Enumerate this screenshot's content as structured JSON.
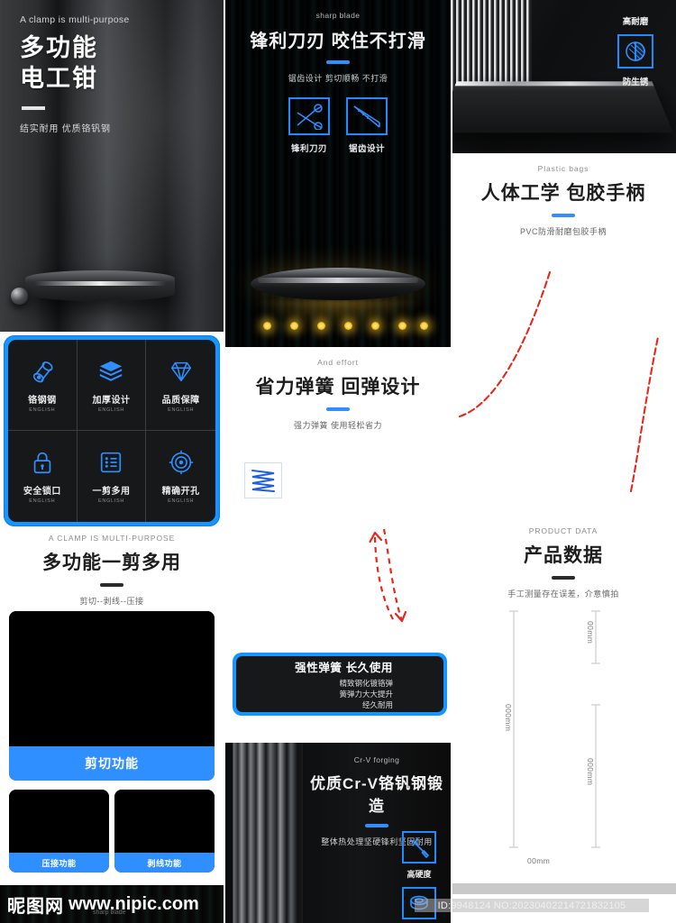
{
  "hero": {
    "eyebrow": "A clamp is multi-purpose",
    "title_line1": "多功能",
    "title_line2": "电工钳",
    "tagline": "结实耐用 优质铬钒钢"
  },
  "feature_grid": {
    "items": [
      {
        "label": "铬钢钢",
        "english": "ENGLISH",
        "icon": "steel-bar-icon"
      },
      {
        "label": "加厚设计",
        "english": "ENGLISH",
        "icon": "layers-icon"
      },
      {
        "label": "品质保障",
        "english": "ENGLISH",
        "icon": "diamond-icon"
      },
      {
        "label": "安全锁口",
        "english": "ENGLISH",
        "icon": "lock-icon"
      },
      {
        "label": "一剪多用",
        "english": "ENGLISH",
        "icon": "list-icon"
      },
      {
        "label": "精确开孔",
        "english": "ENGLISH",
        "icon": "target-icon"
      }
    ]
  },
  "multipurpose": {
    "eyebrow": "A CLAMP IS MULTI-PURPOSE",
    "title": "多功能一剪多用",
    "subtitle": "剪切--剥线--压接"
  },
  "function_cards": {
    "main": {
      "caption": "剪切功能"
    },
    "left": {
      "caption": "压接功能"
    },
    "right": {
      "caption": "剥线功能"
    }
  },
  "footer_watermark": {
    "brand": "昵图网",
    "url": "www.nipic.com",
    "small": "sharp blade"
  },
  "blade": {
    "eyebrow": "sharp blade",
    "title": "锋利刀刃 咬住不打滑",
    "subtitle": "锯齿设计 剪切顺畅 不打滑",
    "icons": [
      {
        "label": "锋利刀刃",
        "icon": "scissors-icon"
      },
      {
        "label": "锯齿设计",
        "icon": "serrated-blade-icon"
      }
    ]
  },
  "spring": {
    "eyebrow": "And effort",
    "title": "省力弹簧 回弹设计",
    "subtitle": "强力弹簧 使用轻松省力",
    "icon": "spring-coil-icon"
  },
  "spring_box": {
    "title": "强性弹簧 长久使用",
    "line1": "精致钢化镀铬弹",
    "line2": "簧弹力大大提升",
    "line3": "经久耐用"
  },
  "crv": {
    "eyebrow": "Cr-V forging",
    "title": "优质Cr-V铬钒钢锻造",
    "subtitle": "整体热处理坚硬锋利坚固耐用",
    "icons": [
      {
        "label": "高硬度",
        "icon": "hammer-icon"
      },
      {
        "label": "",
        "icon": "ring-icon"
      }
    ]
  },
  "rust": {
    "top_label": "高耐磨",
    "bottom_label": "防生锈",
    "icon": "polish-contrast-icon"
  },
  "handle": {
    "eyebrow": "Plastic bags",
    "title": "人体工学 包胶手柄",
    "subtitle": "PVC防滑耐磨包胶手柄"
  },
  "product_data": {
    "eyebrow": "PRODUCT DATA",
    "title": "产品数据",
    "subtitle": "手工测量存在误差，介意慎拍",
    "dimensions": {
      "left_vertical": "000mm",
      "right_top": "00mm",
      "right_bottom": "000mm",
      "bottom_horizontal": "00mm"
    }
  },
  "id_watermark": {
    "text": "ID:9948124 NO:20230402214721832105"
  },
  "colors": {
    "accent_blue": "#2f8fff",
    "frame_blue": "#1595ff",
    "dark_panel": "#17181a",
    "red_dashed": "#e8271c",
    "gold_light": "#ffd034"
  }
}
